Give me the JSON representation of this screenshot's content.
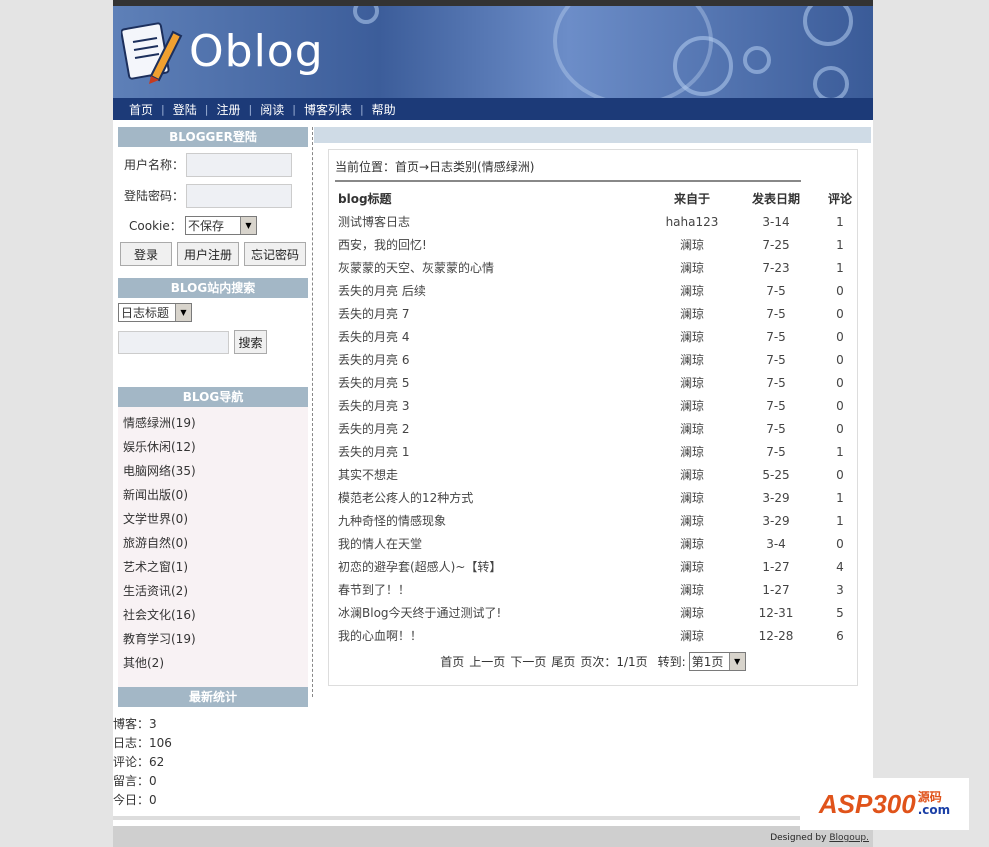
{
  "site": {
    "logo": "Oblog"
  },
  "nav": [
    "首页",
    "登陆",
    "注册",
    "阅读",
    "博客列表",
    "帮助"
  ],
  "login": {
    "heading": "BLOGGER登陆",
    "username_label": "用户名称：",
    "password_label": "登陆密码：",
    "cookie_label": "Cookie：",
    "cookie_value": "不保存",
    "login_button": "登录",
    "register_button": "用户注册",
    "forgot_button": "忘记密码"
  },
  "search": {
    "heading": "BLOG站内搜索",
    "type_value": "日志标题",
    "button": "搜索"
  },
  "categories": {
    "heading": "BLOG导航",
    "items": [
      "情感绿洲(19)",
      "娱乐休闲(12)",
      "电脑网络(35)",
      "新闻出版(0)",
      "文学世界(0)",
      "旅游自然(0)",
      "艺术之窗(1)",
      "生活资讯(2)",
      "社会文化(16)",
      "教育学习(19)",
      "其他(2)"
    ]
  },
  "stats": {
    "heading": "最新统计",
    "items": [
      "博客：3",
      "日志：106",
      "评论：62",
      "留言：0",
      "今日：0"
    ]
  },
  "breadcrumb": "当前位置：首页→日志类别(情感绿洲)",
  "table": {
    "headers": [
      "blog标题",
      "来自于",
      "发表日期",
      "评论"
    ],
    "rows": [
      [
        "测试博客日志",
        "haha123",
        "3-14",
        "1"
      ],
      [
        "西安，我的回忆!",
        "澜琼",
        "7-25",
        "1"
      ],
      [
        "灰蒙蒙的天空、灰蒙蒙的心情",
        "澜琼",
        "7-23",
        "1"
      ],
      [
        "丢失的月亮 后续",
        "澜琼",
        "7-5",
        "0"
      ],
      [
        "丢失的月亮 7",
        "澜琼",
        "7-5",
        "0"
      ],
      [
        "丢失的月亮 4",
        "澜琼",
        "7-5",
        "0"
      ],
      [
        "丢失的月亮 6",
        "澜琼",
        "7-5",
        "0"
      ],
      [
        "丢失的月亮 5",
        "澜琼",
        "7-5",
        "0"
      ],
      [
        "丢失的月亮 3",
        "澜琼",
        "7-5",
        "0"
      ],
      [
        "丢失的月亮 2",
        "澜琼",
        "7-5",
        "0"
      ],
      [
        "丢失的月亮 1",
        "澜琼",
        "7-5",
        "1"
      ],
      [
        "其实不想走",
        "澜琼",
        "5-25",
        "0"
      ],
      [
        "模范老公疼人的12种方式",
        "澜琼",
        "3-29",
        "1"
      ],
      [
        "九种奇怪的情感现象",
        "澜琼",
        "3-29",
        "1"
      ],
      [
        "我的情人在天堂",
        "澜琼",
        "3-4",
        "0"
      ],
      [
        "初恋的避孕套(超感人)~【转】",
        "澜琼",
        "1-27",
        "4"
      ],
      [
        "春节到了！！",
        "澜琼",
        "1-27",
        "3"
      ],
      [
        "冰澜Blog今天终于通过测试了!",
        "澜琼",
        "12-31",
        "5"
      ],
      [
        "我的心血啊！！",
        "澜琼",
        "12-28",
        "6"
      ]
    ]
  },
  "pager": {
    "first": "首页",
    "prev": "上一页",
    "next": "下一页",
    "last": "尾页",
    "info": "页次：1/1页",
    "jump_label": "转到:",
    "jump_value": "第1页"
  },
  "footer": {
    "text": "Designed by ",
    "link": "Blogoup."
  },
  "watermark": {
    "main": "ASP300",
    "side_top": "源码",
    "side_bottom": ".com"
  }
}
